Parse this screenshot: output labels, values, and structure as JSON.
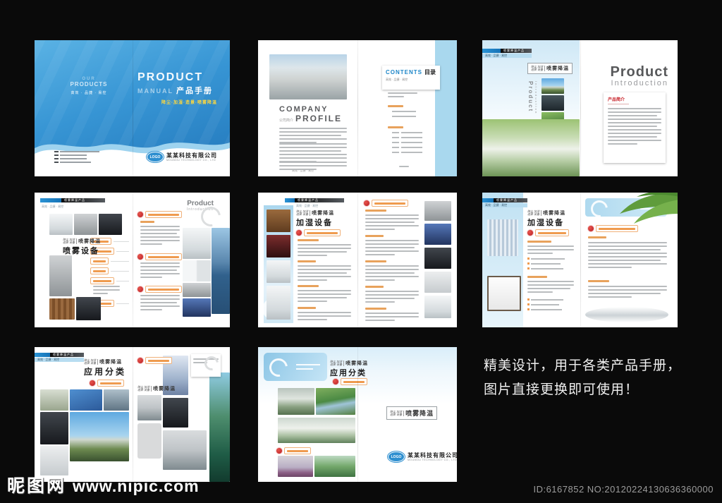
{
  "page": {
    "description_line1": "精美设计，用于各类产品手册，",
    "description_line2": "图片直接更换即可使用！",
    "watermark_site": "昵图网",
    "watermark_url": "www.nipic.com",
    "watermark_id": "ID:6167852 NO:20120224130636360000"
  },
  "brand": {
    "logo_text": "LOGO",
    "company_cn": "某某科技有限公司",
    "company_en": "MOUMOU TECHNOLOGY CO., LTD",
    "tagline": "高效 · 品捷 · 易控",
    "header_tab": "喷雾降温产品",
    "lockup_prefix_line1": "降尘 加湿",
    "lockup_prefix_line2": "造景 设备",
    "lockup_main": "喷雾降温",
    "colors": {
      "cover_blue": "#2e8fd0",
      "light_blue": "#a9d8ee",
      "accent_orange": "#e8821e",
      "accent_red": "#c9252c",
      "accent_yellow": "#ffd83d",
      "title_gray": "#58595b"
    }
  },
  "cover": {
    "kicker_line1": "OUR",
    "kicker_line2": "PRODUCTS",
    "title_en": "PRODUCT",
    "subtitle_en": "MANUAL",
    "title_cn": "产品手册",
    "subtitle_yellow": "降尘·加湿·造景·喷雾降温"
  },
  "profile": {
    "title_en_1": "COMPANY",
    "title_en_2": "PROFILE",
    "title_cn": "公司简介",
    "contents_en": "CONTENTS",
    "contents_cn": "目录"
  },
  "intro": {
    "headline_en": "Product",
    "headline_sub": "Introduction",
    "section_cn": "产品简介"
  },
  "sections": {
    "spray_title": "喷雾设备",
    "humidify_title": "加湿设备",
    "apps_title": "应用分类",
    "corner_en": "Product",
    "corner_sub": "Introduction"
  }
}
